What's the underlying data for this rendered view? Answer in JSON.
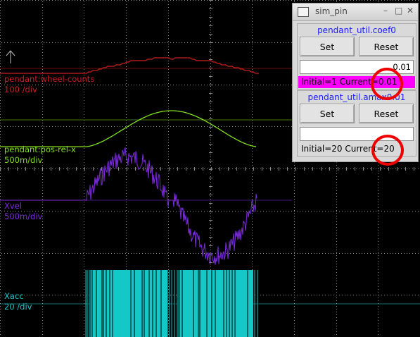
{
  "scope": {
    "traces": [
      {
        "id": "wheel",
        "label": "pendant:wheel-counts",
        "scale": "100 /div",
        "color": "#cc1f1f"
      },
      {
        "id": "posrel",
        "label": "pendant:pos-rel-x",
        "scale": "500m/div",
        "color": "#7fe020"
      },
      {
        "id": "xvel",
        "label": "Xvel",
        "scale": "500m/div",
        "color": "#7b2cd9"
      },
      {
        "id": "xacc",
        "label": "Xacc",
        "scale": "20 /div",
        "color": "#15c8c8"
      }
    ],
    "cursor_icon": "up-arrow-icon"
  },
  "window": {
    "title": "sim_pin",
    "controls": {
      "minimize": "–",
      "maximize": "□",
      "close": "✕"
    },
    "icon": "window-icon",
    "pins": [
      {
        "name": "pendant_util.coef0",
        "set_label": "Set",
        "reset_label": "Reset",
        "entry_value": "0.01",
        "status": "Initial=1 Current=0.01",
        "status_bg": "#ff00ff"
      },
      {
        "name": "pendant_util.amax0.01",
        "set_label": "Set",
        "reset_label": "Reset",
        "entry_value": "",
        "status": "Initial=20 Current=20",
        "status_bg": "#d9d9d9"
      }
    ]
  },
  "annotations": [
    "red-circle-current-coef0",
    "red-circle-entry-coef0",
    "red-circle-current-amax"
  ]
}
